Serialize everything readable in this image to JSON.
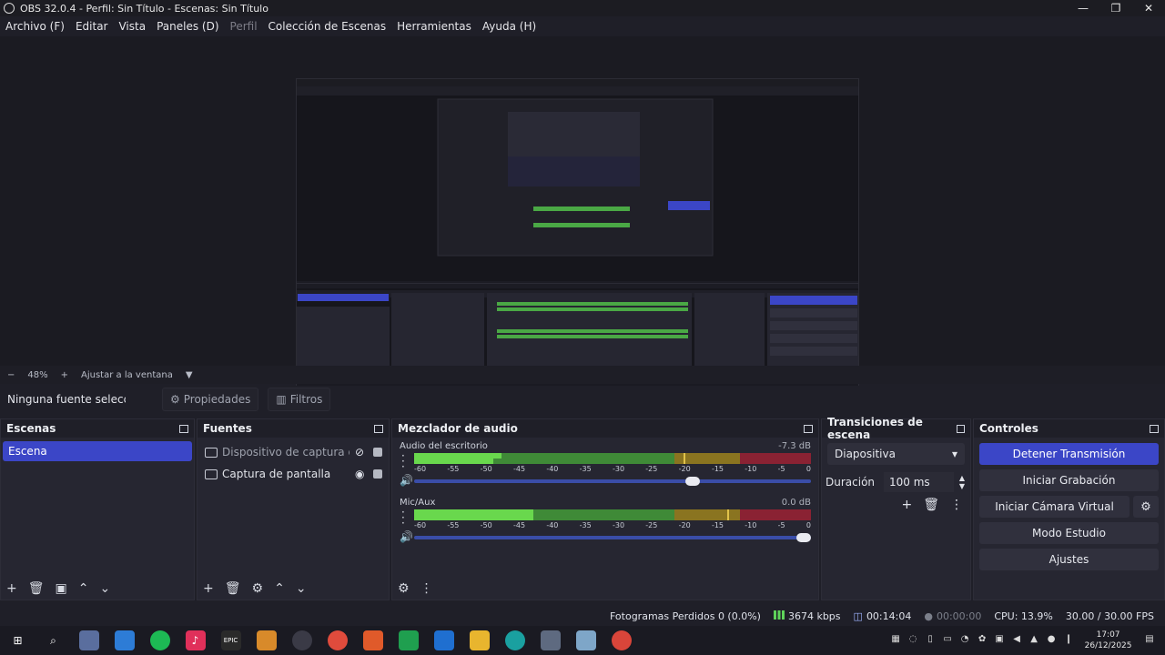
{
  "window": {
    "title": "OBS 32.0.4 - Perfil: Sin Título - Escenas: Sin Título",
    "minimize": "—",
    "maximize": "❐",
    "close": "✕"
  },
  "menu": [
    "Archivo (F)",
    "Editar",
    "Vista",
    "Paneles (D)",
    "Perfil",
    "Colección de Escenas",
    "Herramientas",
    "Ayuda (H)"
  ],
  "zoom": {
    "minus": "−",
    "value": "48%",
    "plus": "+",
    "fit_label": "Ajustar a la ventana",
    "dropdown": "▼"
  },
  "source_toolbar": {
    "no_source": "Ninguna fuente seleccionada",
    "properties": "Propiedades",
    "filters": "Filtros"
  },
  "scenes": {
    "title": "Escenas",
    "items": [
      "Escena"
    ]
  },
  "sources": {
    "title": "Fuentes",
    "items": [
      {
        "label": "Dispositivo de captura de video",
        "icon": "camera-icon"
      },
      {
        "label": "Captura de pantalla",
        "icon": "monitor-icon"
      }
    ]
  },
  "mixer": {
    "title": "Mezclador de audio",
    "scale": [
      "-60",
      "-55",
      "-50",
      "-45",
      "-40",
      "-35",
      "-30",
      "-25",
      "-20",
      "-15",
      "-10",
      "-5",
      "0"
    ],
    "channels": [
      {
        "name": "Audio del escritorio",
        "db": "-7.3 dB",
        "level1": 0.22,
        "level2": 0.2,
        "peak": 0.68,
        "volume": 0.72
      },
      {
        "name": "Mic/Aux",
        "db": "0.0 dB",
        "level1": 0.3,
        "level2": 0.3,
        "peak": 0.79,
        "volume": 1.0
      }
    ]
  },
  "transitions": {
    "title": "Transiciones de escena",
    "selected": "Diapositiva",
    "duration_label": "Duración",
    "duration_value": "100 ms"
  },
  "controls": {
    "title": "Controles",
    "buttons": [
      "Detener Transmisión",
      "Iniciar Grabación",
      "Iniciar Cámara Virtual",
      "Modo Estudio",
      "Ajustes"
    ]
  },
  "status": {
    "dropped_frames": "Fotogramas Perdidos 0 (0.0%)",
    "bitrate": "3674 kbps",
    "stream_time": "00:14:04",
    "rec_time": "00:00:00",
    "cpu": "CPU: 13.9%",
    "fps": "30.00 / 30.00 FPS"
  },
  "taskbar": {
    "time": "17:07",
    "date": "26/12/2025"
  },
  "colors": {
    "accent": "#3b46c7",
    "meter_green": "#69d84d",
    "meter_yellow": "#8a7420",
    "meter_red": "#8a2233"
  }
}
